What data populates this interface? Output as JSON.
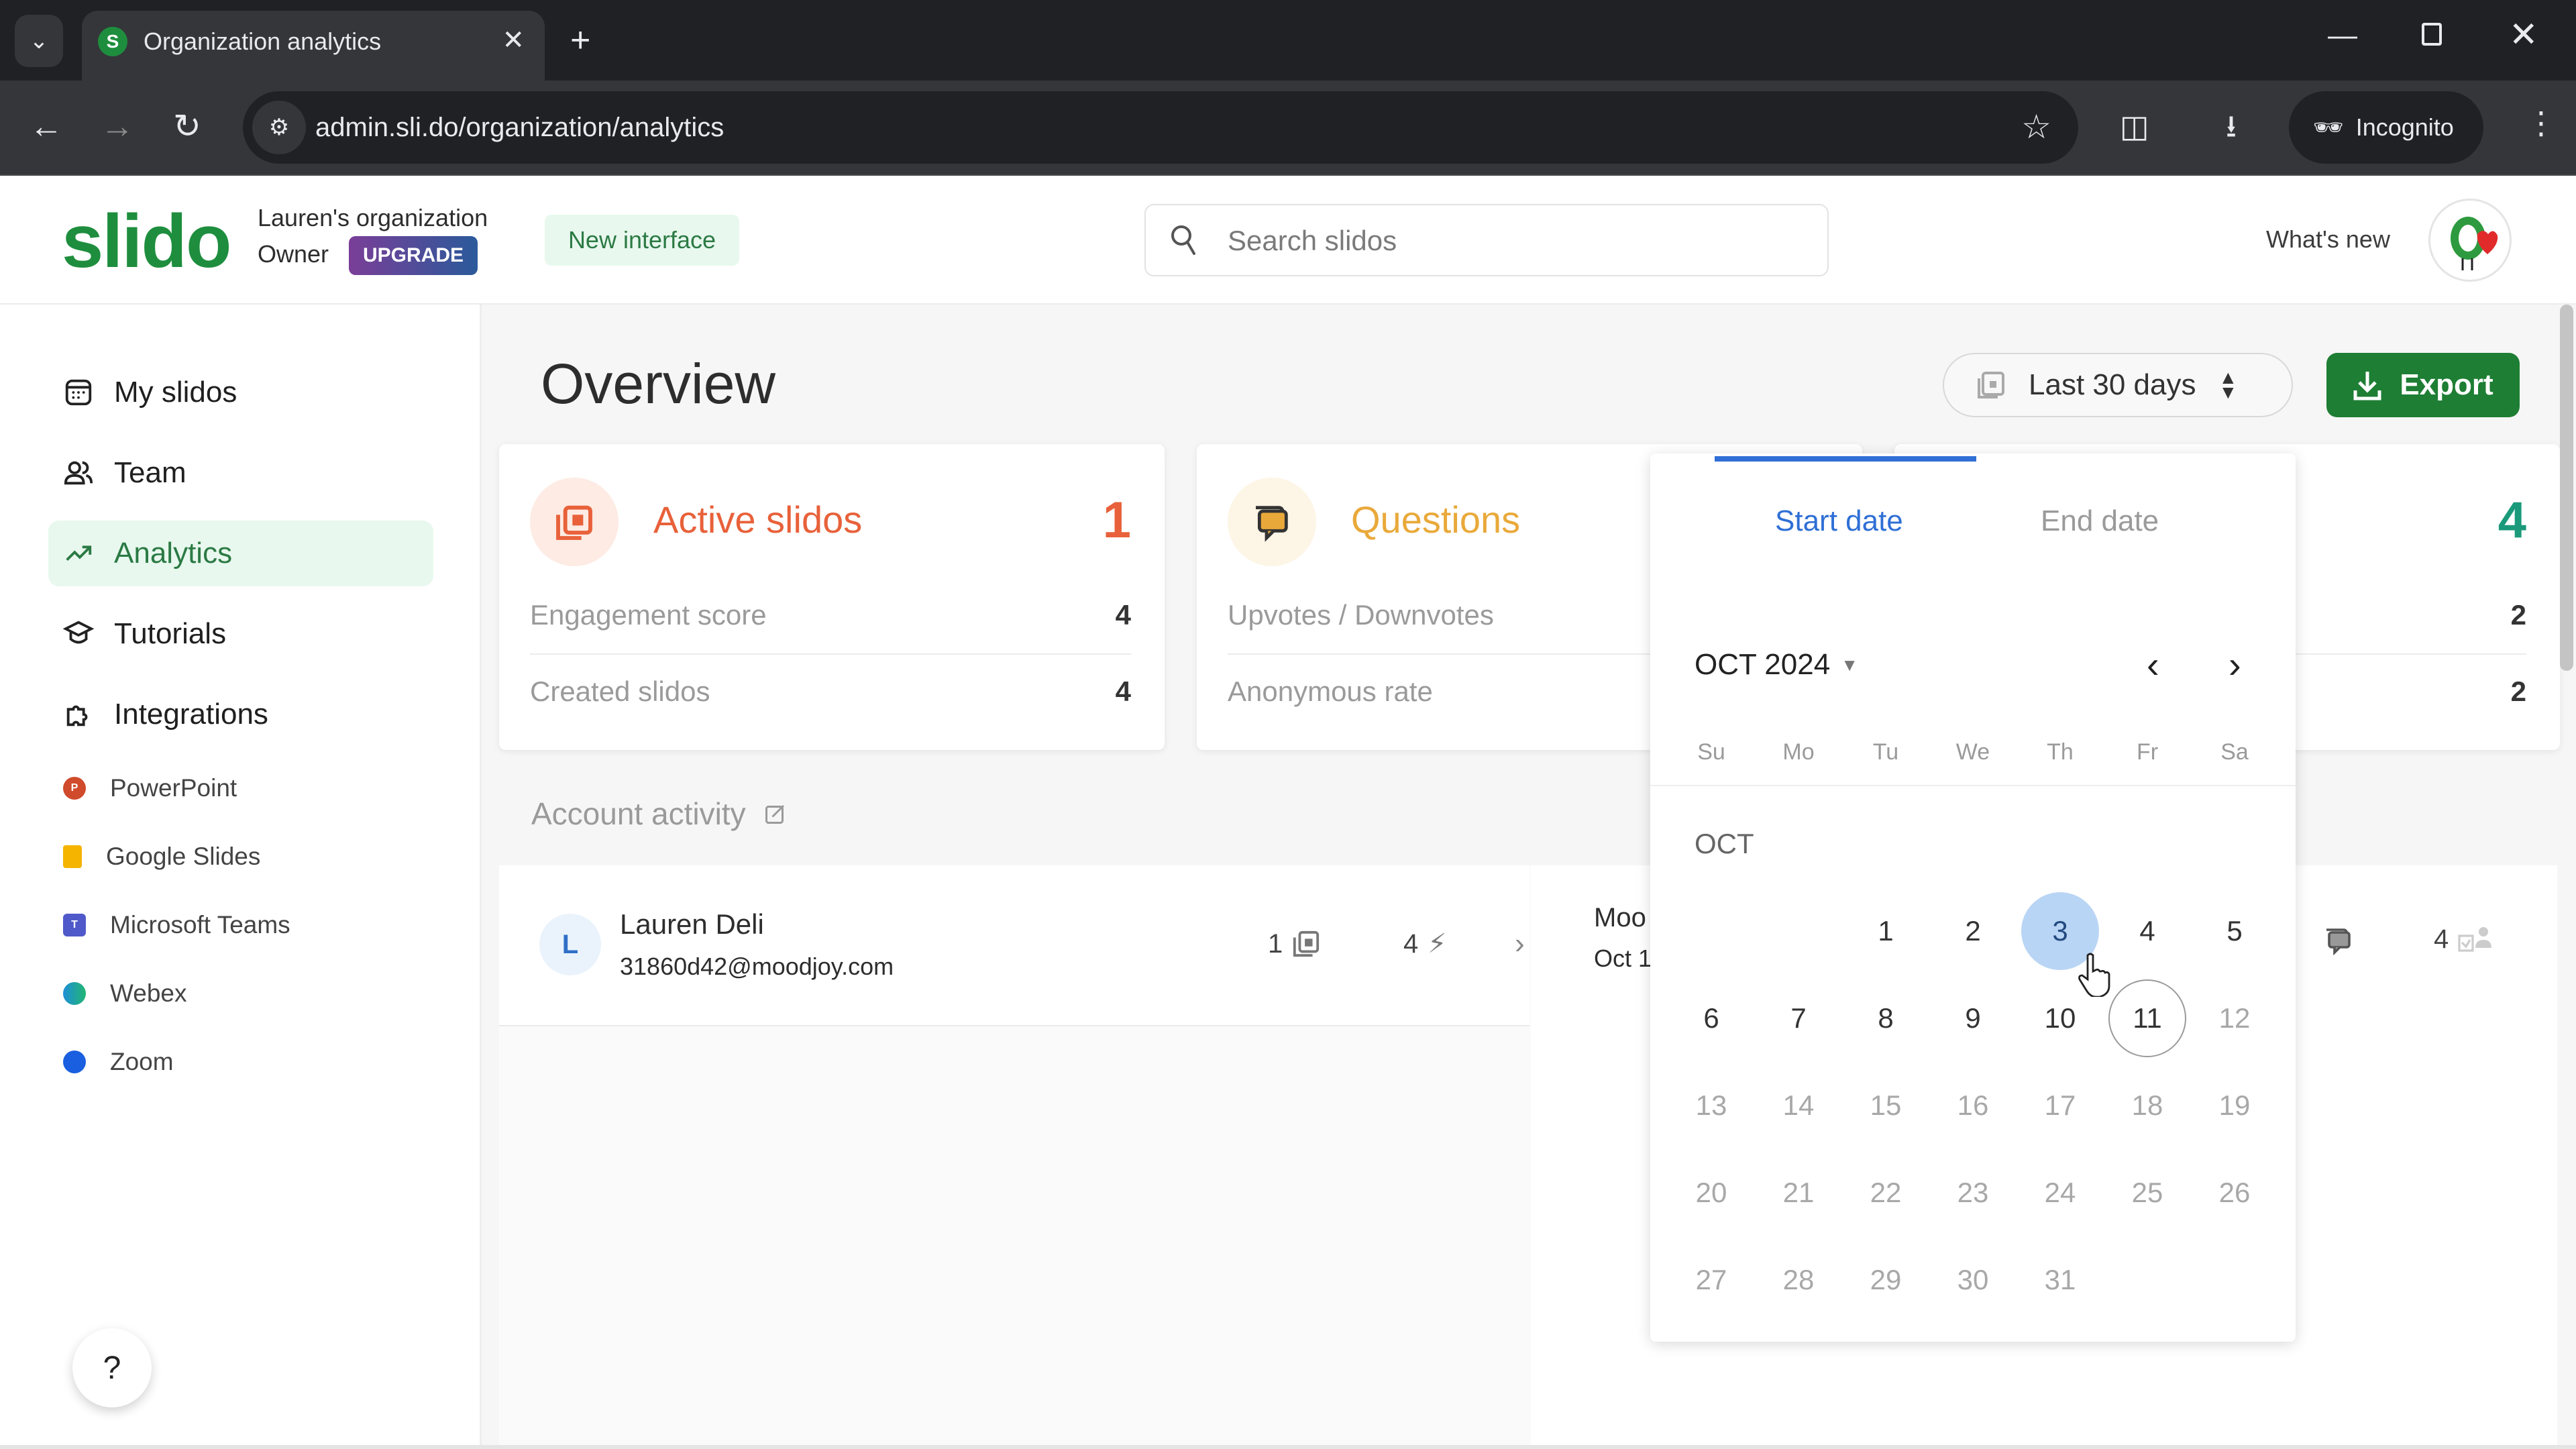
{
  "browser": {
    "tab_title": "Organization analytics",
    "tab_favicon_letter": "S",
    "url": "admin.sli.do/organization/analytics",
    "incognito_label": "Incognito"
  },
  "header": {
    "logo": "slido",
    "org_name": "Lauren's organization",
    "role": "Owner",
    "upgrade_label": "UPGRADE",
    "new_interface_label": "New interface",
    "search_placeholder": "Search slidos",
    "whats_new_label": "What's new"
  },
  "sidebar": {
    "items": [
      {
        "label": "My slidos",
        "icon": "calendar-icon",
        "active": false
      },
      {
        "label": "Team",
        "icon": "team-icon",
        "active": false
      },
      {
        "label": "Analytics",
        "icon": "trend-icon",
        "active": true
      },
      {
        "label": "Tutorials",
        "icon": "graduation-cap-icon",
        "active": false
      },
      {
        "label": "Integrations",
        "icon": "puzzle-icon",
        "active": false
      }
    ],
    "integrations": [
      {
        "label": "PowerPoint",
        "color": "#d04a2c"
      },
      {
        "label": "Google Slides",
        "color": "#f4b400"
      },
      {
        "label": "Microsoft Teams",
        "color": "#5059c9"
      },
      {
        "label": "Webex",
        "color": "#1d8fd6"
      },
      {
        "label": "Zoom",
        "color": "#1a5fe0"
      }
    ],
    "help_label": "?"
  },
  "main": {
    "title": "Overview",
    "date_range": "Last 30 days",
    "export_label": "Export",
    "cards": [
      {
        "title": "Active slidos",
        "value": "1",
        "color": "#e8613a",
        "rows": [
          {
            "label": "Engagement score",
            "value": "4"
          },
          {
            "label": "Created slidos",
            "value": "4"
          }
        ]
      },
      {
        "title": "Questions",
        "value": "",
        "color": "#e9a93a",
        "rows": [
          {
            "label": "Upvotes / Downvotes",
            "value": ""
          },
          {
            "label": "Anonymous rate",
            "value": ""
          }
        ]
      },
      {
        "title": "",
        "value": "4",
        "color": "#1a9a7a",
        "rows": [
          {
            "label": "",
            "value": "2"
          },
          {
            "label": "",
            "value": "2"
          }
        ]
      }
    ],
    "activity": {
      "heading": "Account activity",
      "user": {
        "initial": "L",
        "name": "Lauren Deli",
        "email": "31860d42@moodjoy.com",
        "slidos_count": "1",
        "engagement_count": "4"
      },
      "event_title_partial": "Moo",
      "event_date_partial": "Oct 1",
      "participants_count": "4"
    }
  },
  "datepicker": {
    "tabs": [
      {
        "label": "Start date",
        "active": true
      },
      {
        "label": "End date",
        "active": false
      }
    ],
    "month_year": "OCT 2024",
    "month_label": "OCT",
    "weekdays": [
      "Su",
      "Mo",
      "Tu",
      "We",
      "Th",
      "Fr",
      "Sa"
    ],
    "first_weekday_index": 2,
    "days_in_month": 31,
    "selected_day": 3,
    "today": 11,
    "last_enabled_day": 11
  }
}
